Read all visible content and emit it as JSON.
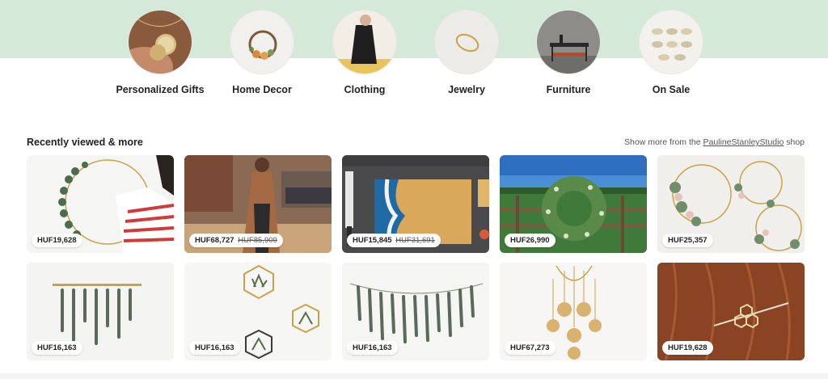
{
  "categories": [
    {
      "label": "Personalized Gifts",
      "icon": "necklace-photo"
    },
    {
      "label": "Home Decor",
      "icon": "wreath-photo"
    },
    {
      "label": "Clothing",
      "icon": "clothing-photo"
    },
    {
      "label": "Jewelry",
      "icon": "ring-photo"
    },
    {
      "label": "Furniture",
      "icon": "table-photo"
    },
    {
      "label": "On Sale",
      "icon": "sale-photo"
    }
  ],
  "recent": {
    "title": "Recently viewed & more",
    "show_more_prefix": "Show more from the ",
    "shop_name": "PaulineStanleyStudio",
    "show_more_suffix": " shop"
  },
  "items": [
    {
      "price": "HUF19,628",
      "original": ""
    },
    {
      "price": "HUF68,727",
      "original": "HUF85,909"
    },
    {
      "price": "HUF15,845",
      "original": "HUF31,691"
    },
    {
      "price": "HUF26,990",
      "original": ""
    },
    {
      "price": "HUF25,357",
      "original": ""
    },
    {
      "price": "HUF16,163",
      "original": ""
    },
    {
      "price": "HUF16,163",
      "original": ""
    },
    {
      "price": "HUF16,163",
      "original": ""
    },
    {
      "price": "HUF67,273",
      "original": ""
    },
    {
      "price": "HUF19,628",
      "original": ""
    }
  ],
  "colors": {
    "hero_band": "#d4e9d7",
    "text": "#222222"
  }
}
